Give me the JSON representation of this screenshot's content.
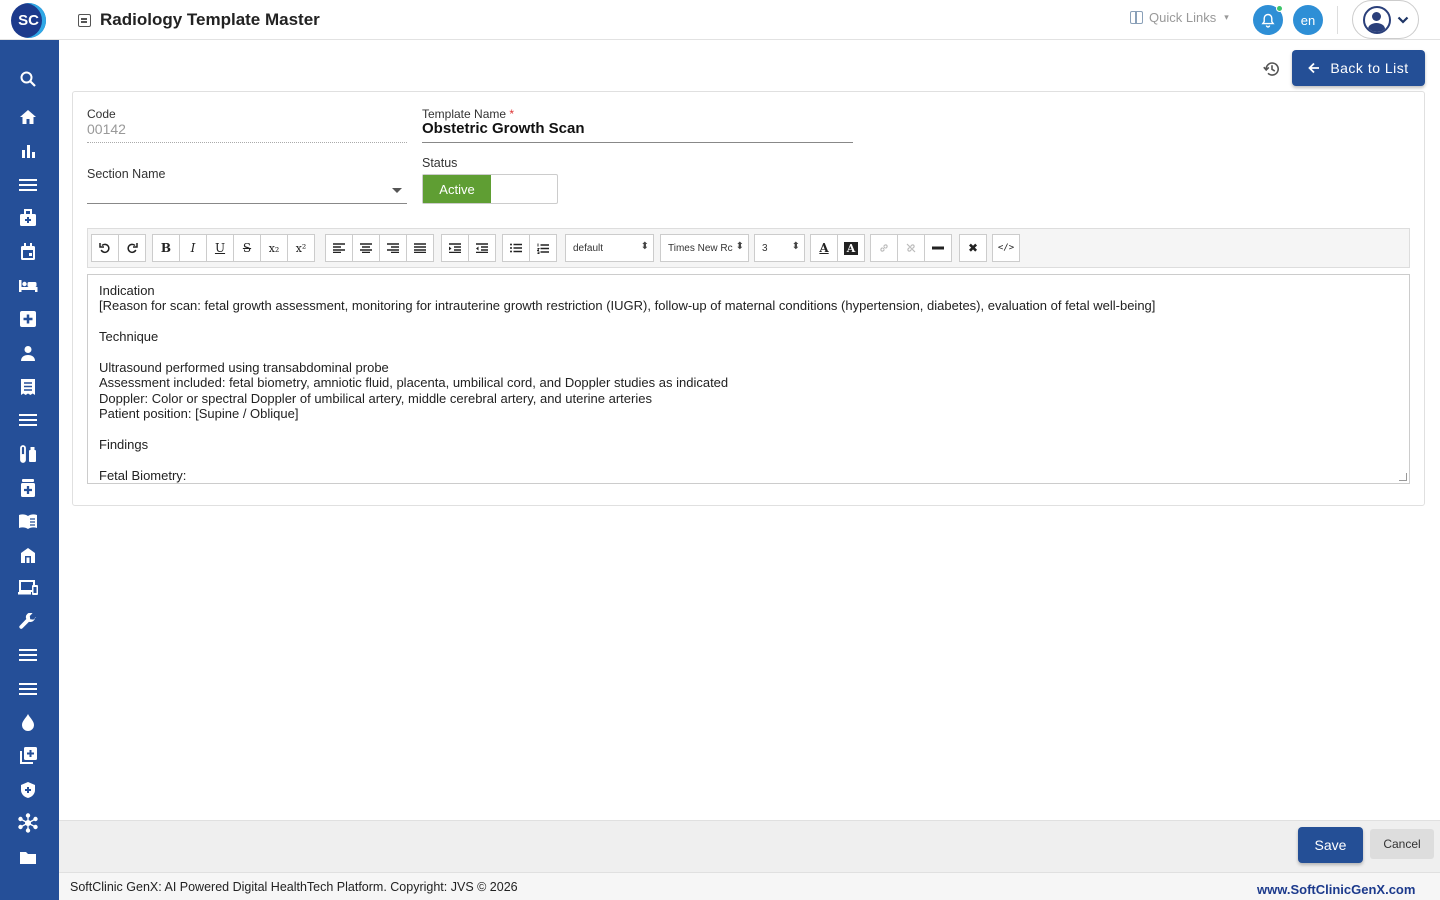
{
  "app": {
    "logo_text": "SC",
    "title": "Radiology Template Master"
  },
  "header": {
    "quick_links": "Quick Links",
    "language": "en"
  },
  "sidebar": {
    "icons": [
      "search-icon",
      "home-icon",
      "analytics-icon",
      "menu-icon",
      "medical-bag-icon",
      "calendar-icon",
      "bed-icon",
      "hospital-plus-icon",
      "person-icon",
      "receipt-icon",
      "list-icon",
      "lab-test-icon",
      "pharmacy-icon",
      "book-icon",
      "store-icon",
      "devices-icon",
      "wrench-icon",
      "list-icon",
      "list-icon",
      "blood-drop-icon",
      "add-box-icon",
      "shield-icon",
      "network-icon",
      "folder-icon"
    ]
  },
  "actions": {
    "back_to_list": "Back to List",
    "save": "Save",
    "cancel": "Cancel"
  },
  "form": {
    "code_label": "Code",
    "code_value": "00142",
    "template_name_label": "Template Name",
    "required_mark": "*",
    "template_name_value": "Obstetric Growth Scan",
    "section_name_label": "Section Name",
    "section_name_value": "",
    "status_label": "Status",
    "status_value": "Active"
  },
  "editor": {
    "toolbar": {
      "format_select": "default",
      "font_select": "Times New Rc",
      "size_select": "3"
    },
    "content_lines": [
      "Indication",
      "[Reason for scan: fetal growth assessment, monitoring for intrauterine growth restriction (IUGR), follow-up of maternal conditions (hypertension, diabetes), evaluation of fetal well-being]",
      "",
      "Technique",
      "",
      "Ultrasound performed using transabdominal probe",
      "Assessment included: fetal biometry, amniotic fluid, placenta, umbilical cord, and Doppler studies as indicated",
      "Doppler: Color or spectral Doppler of umbilical artery, middle cerebral artery, and uterine arteries",
      "Patient position: [Supine / Oblique]",
      "",
      "Findings",
      "",
      "Fetal Biometry:"
    ]
  },
  "footer": {
    "copyright": "SoftClinic GenX: AI Powered Digital HealthTech Platform. Copyright: JVS © 2026",
    "website": "www.SoftClinicGenX.com"
  },
  "colors": {
    "sidebar": "#254f98",
    "primary_button": "#244f96",
    "status_active": "#5f9e33",
    "notification": "#2e8fd6"
  }
}
